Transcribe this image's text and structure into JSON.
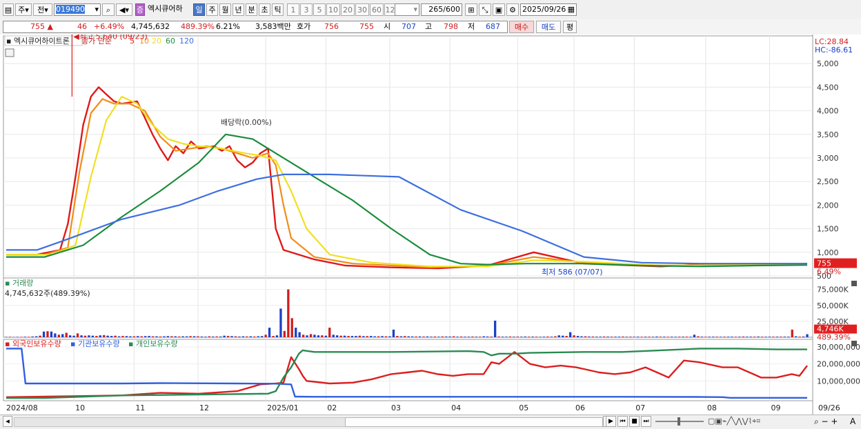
{
  "toolbar": {
    "period_prefix": "주",
    "prev_label": "전",
    "code": "019490",
    "stock_badge": "증",
    "stock_name": "엑시큐어하",
    "period_tabs": [
      "일",
      "주",
      "월",
      "년",
      "분",
      "초",
      "틱"
    ],
    "active_tab": "일",
    "intervals": [
      "1",
      "3",
      "5",
      "10",
      "20",
      "30",
      "60",
      "120"
    ],
    "count": "265",
    "count_max": "/600",
    "date": "2025/09/26"
  },
  "quote": {
    "price": "755",
    "change": "46",
    "change_pct": "+6.49%",
    "volume": "4,745,632",
    "volume_ratio": "489.39%",
    "turnover": "6.21%",
    "amount": "3,583백만",
    "ask_label": "호가",
    "ask": "756",
    "bid": "755",
    "open_label": "시",
    "open": "707",
    "high_label": "고",
    "high": "798",
    "low_label": "저",
    "low": "687",
    "buy_label": "매수",
    "sell_label": "매도",
    "eval_label": "평"
  },
  "colors": {
    "up": "#d21c1c",
    "down": "#1a40c8",
    "ma5": "#e01818",
    "ma10": "#f08c18",
    "ma20": "#f0e020",
    "ma60": "#1a8c3c",
    "ma120": "#3c6ee0"
  },
  "chart_data": [
    {
      "type": "line",
      "title": "엑시큐어하이트론",
      "legend": [
        "종가 단순",
        "5",
        "10",
        "20",
        "60",
        "120"
      ],
      "x_ticks": [
        "2024/08",
        "10",
        "11",
        "12",
        "2025/01",
        "02",
        "03",
        "04",
        "05",
        "06",
        "07",
        "08",
        "09",
        "09/26"
      ],
      "y_ticks": [
        500,
        1000,
        1500,
        2000,
        2500,
        3000,
        3500,
        4000,
        4500,
        5000
      ],
      "ylim": [
        500,
        5500
      ],
      "lc_label": "LC:28.84",
      "hc_label": "HC:-86.61",
      "high_annotation": "최고 5,640 (09/23)",
      "low_annotation": "최저 586 (07/07)",
      "dividend_annotation": "배당락(0.00%)",
      "last_price_label": "755",
      "last_pct_label": "6.49%",
      "series": [
        {
          "name": "5",
          "x": [
            0,
            8,
            14,
            16,
            18,
            20,
            22,
            24,
            26,
            28,
            30,
            34,
            38,
            40,
            42,
            44,
            46,
            48,
            50,
            54,
            56,
            58,
            60,
            62,
            64,
            66,
            68,
            70,
            72,
            80,
            88,
            100,
            112,
            125,
            137,
            150,
            160,
            170,
            180,
            200,
            204,
            208
          ],
          "y": [
            950,
            950,
            1050,
            1600,
            2600,
            3700,
            4300,
            4500,
            4350,
            4200,
            4150,
            4200,
            3500,
            3200,
            2950,
            3250,
            3100,
            3350,
            3200,
            3250,
            3150,
            3250,
            2950,
            2800,
            2900,
            3100,
            3200,
            1500,
            1050,
            850,
            720,
            680,
            660,
            720,
            1000,
            760,
            730,
            700,
            740,
            730,
            740,
            760
          ]
        },
        {
          "name": "10",
          "x": [
            0,
            10,
            16,
            19,
            22,
            25,
            28,
            32,
            36,
            40,
            44,
            48,
            52,
            56,
            60,
            64,
            68,
            70,
            72,
            74,
            80,
            90,
            110,
            125,
            137,
            150,
            170,
            208
          ],
          "y": [
            950,
            950,
            1100,
            2700,
            3950,
            4250,
            4150,
            4150,
            4000,
            3450,
            3150,
            3200,
            3250,
            3200,
            3100,
            3000,
            3100,
            2850,
            2000,
            1300,
            900,
            760,
            680,
            720,
            900,
            780,
            720,
            740
          ]
        },
        {
          "name": "20",
          "x": [
            0,
            12,
            18,
            22,
            26,
            30,
            34,
            38,
            42,
            46,
            50,
            56,
            62,
            66,
            70,
            74,
            78,
            84,
            95,
            110,
            125,
            137,
            150,
            170,
            208
          ],
          "y": [
            950,
            950,
            1150,
            2600,
            3800,
            4300,
            4150,
            3700,
            3400,
            3300,
            3250,
            3200,
            3100,
            3050,
            2950,
            2300,
            1500,
            950,
            780,
            700,
            700,
            830,
            800,
            720,
            740
          ]
        },
        {
          "name": "60",
          "x": [
            0,
            10,
            20,
            30,
            40,
            50,
            57,
            64,
            70,
            80,
            90,
            100,
            110,
            118,
            125,
            135,
            150,
            165,
            180,
            195,
            208
          ],
          "y": [
            900,
            900,
            1150,
            1750,
            2300,
            2900,
            3500,
            3400,
            3100,
            2600,
            2100,
            1500,
            950,
            760,
            740,
            760,
            760,
            720,
            700,
            720,
            730
          ]
        },
        {
          "name": "120",
          "x": [
            0,
            8,
            15,
            30,
            45,
            55,
            65,
            72,
            84,
            102,
            118,
            134,
            150,
            165,
            180,
            208
          ],
          "y": [
            1050,
            1050,
            1250,
            1700,
            2000,
            2300,
            2550,
            2650,
            2650,
            2600,
            1900,
            1450,
            900,
            780,
            760,
            760
          ]
        }
      ]
    },
    {
      "type": "bar",
      "title": "거래량",
      "value_label": "4,745,632주(489.39%)",
      "y_ticks": [
        "25,000K",
        "50,000K",
        "75,000K"
      ],
      "last_label": "4,746K",
      "last_pct_label": "489.39%",
      "ylim": [
        0,
        80000
      ],
      "values": [
        600,
        800,
        500,
        700,
        600,
        900,
        800,
        1200,
        1500,
        2500,
        9000,
        9500,
        9000,
        6000,
        4000,
        5000,
        7000,
        3000,
        2500,
        6000,
        3000,
        2500,
        3000,
        2500,
        2000,
        3000,
        3500,
        2500,
        2000,
        2500,
        1500,
        2000,
        1800,
        1500,
        1500,
        1800,
        1500,
        1800,
        2000,
        1500,
        1500,
        1200,
        1500,
        1800,
        1600,
        1500,
        1200,
        1500,
        1400,
        1800,
        1600,
        1500,
        1200,
        1000,
        1500,
        1200,
        1300,
        1200,
        2500,
        2000,
        1800,
        1500,
        1200,
        1500,
        1300,
        1500,
        1200,
        1600,
        1800,
        4000,
        15000,
        2000,
        3000,
        45000,
        10000,
        75000,
        30000,
        15000,
        8000,
        4000,
        3000,
        5000,
        4000,
        3000,
        3000,
        2500,
        15000,
        4000,
        3000,
        2500,
        2500,
        2000,
        2000,
        2000,
        2500,
        1800,
        1800,
        2000,
        1500,
        1500,
        1800,
        1500,
        1500,
        12000,
        2000,
        1500,
        1800,
        1500,
        1300,
        1200,
        1300,
        1200,
        1300,
        1000,
        1200,
        1000,
        1300,
        1200,
        1200,
        1500,
        1000,
        1200,
        1000,
        1000,
        1200,
        1000,
        1000,
        1500,
        1200,
        1100,
        26000,
        1200,
        1000,
        1000,
        1200,
        1000,
        1100,
        1000,
        1200,
        1000,
        1100,
        1000,
        900,
        1000,
        1200,
        1000,
        1500,
        3000,
        2500,
        2000,
        8000,
        3000,
        2000,
        1500,
        1500,
        1200,
        1200,
        1000,
        1000,
        1200,
        1100,
        1000,
        1000,
        1000,
        1200,
        900,
        1000,
        900,
        1000,
        900,
        1000,
        1000,
        900,
        1200,
        1000,
        1000,
        900,
        1000,
        900,
        1000,
        1000,
        1000,
        900,
        4000,
        1500,
        1000,
        900,
        1000,
        1000,
        1000,
        900,
        1000,
        1000,
        1000,
        900,
        1000,
        1200,
        1000,
        1000,
        1000,
        1200,
        1000,
        900,
        1000,
        1000,
        1000,
        1000,
        1000,
        1000,
        12000,
        1500,
        1000,
        1200,
        4746
      ]
    },
    {
      "type": "line",
      "legend": [
        "외국인보유수량",
        "기관보유수량",
        "개인보유수량"
      ],
      "y_ticks": [
        "10,000,000",
        "20,000,000",
        "30,000,000"
      ],
      "ylim": [
        0,
        32000000
      ],
      "series": [
        {
          "name": "외국인보유수량",
          "x": [
            0,
            30,
            40,
            50,
            60,
            66,
            70,
            72,
            74,
            76,
            77,
            78,
            80,
            84,
            90,
            95,
            100,
            104,
            108,
            112,
            116,
            120,
            124,
            126,
            128,
            132,
            136,
            140,
            144,
            148,
            150,
            154,
            158,
            162,
            166,
            170,
            172,
            176,
            180,
            186,
            190,
            194,
            196,
            200,
            204,
            206,
            208
          ],
          "y": [
            500000,
            1500000,
            3000000,
            2500000,
            4000000,
            8000000,
            8500000,
            9000000,
            24000000,
            17000000,
            13000000,
            10000000,
            9500000,
            8500000,
            9000000,
            11000000,
            14000000,
            15000000,
            16000000,
            14000000,
            13000000,
            14000000,
            14000000,
            21000000,
            20000000,
            27000000,
            20000000,
            18000000,
            19000000,
            18000000,
            17000000,
            15000000,
            14000000,
            15000000,
            18000000,
            14000000,
            12000000,
            22000000,
            21000000,
            18000000,
            18000000,
            14000000,
            12000000,
            12000000,
            14000000,
            13000000,
            19000000
          ]
        },
        {
          "name": "기관보유수량",
          "x": [
            0,
            4,
            5,
            30,
            40,
            60,
            70,
            72,
            74,
            75,
            80,
            100,
            120,
            140,
            160,
            180,
            186,
            188,
            208
          ],
          "y": [
            29000000,
            29000000,
            8500000,
            8500000,
            8700000,
            8500000,
            8400000,
            8200000,
            8000000,
            800000,
            700000,
            700000,
            700000,
            700000,
            700000,
            600000,
            500000,
            100000,
            100000
          ]
        },
        {
          "name": "개인보유수량",
          "x": [
            0,
            10,
            30,
            50,
            68,
            70,
            72,
            74,
            76,
            77,
            80,
            90,
            100,
            120,
            124,
            126,
            128,
            132,
            136,
            150,
            160,
            170,
            180,
            190,
            200,
            208
          ],
          "y": [
            0,
            0,
            1500000,
            2000000,
            2500000,
            4000000,
            12000000,
            18000000,
            26000000,
            28000000,
            27000000,
            27000000,
            27000000,
            27500000,
            27000000,
            25000000,
            26000000,
            26000000,
            26500000,
            27000000,
            27000000,
            28000000,
            29000000,
            29000000,
            28500000,
            28500000
          ]
        }
      ]
    }
  ],
  "bottom_bar": {
    "nav_buttons": [
      "▶",
      "⏮",
      "■",
      "⏭"
    ],
    "zoom_label": "A"
  }
}
